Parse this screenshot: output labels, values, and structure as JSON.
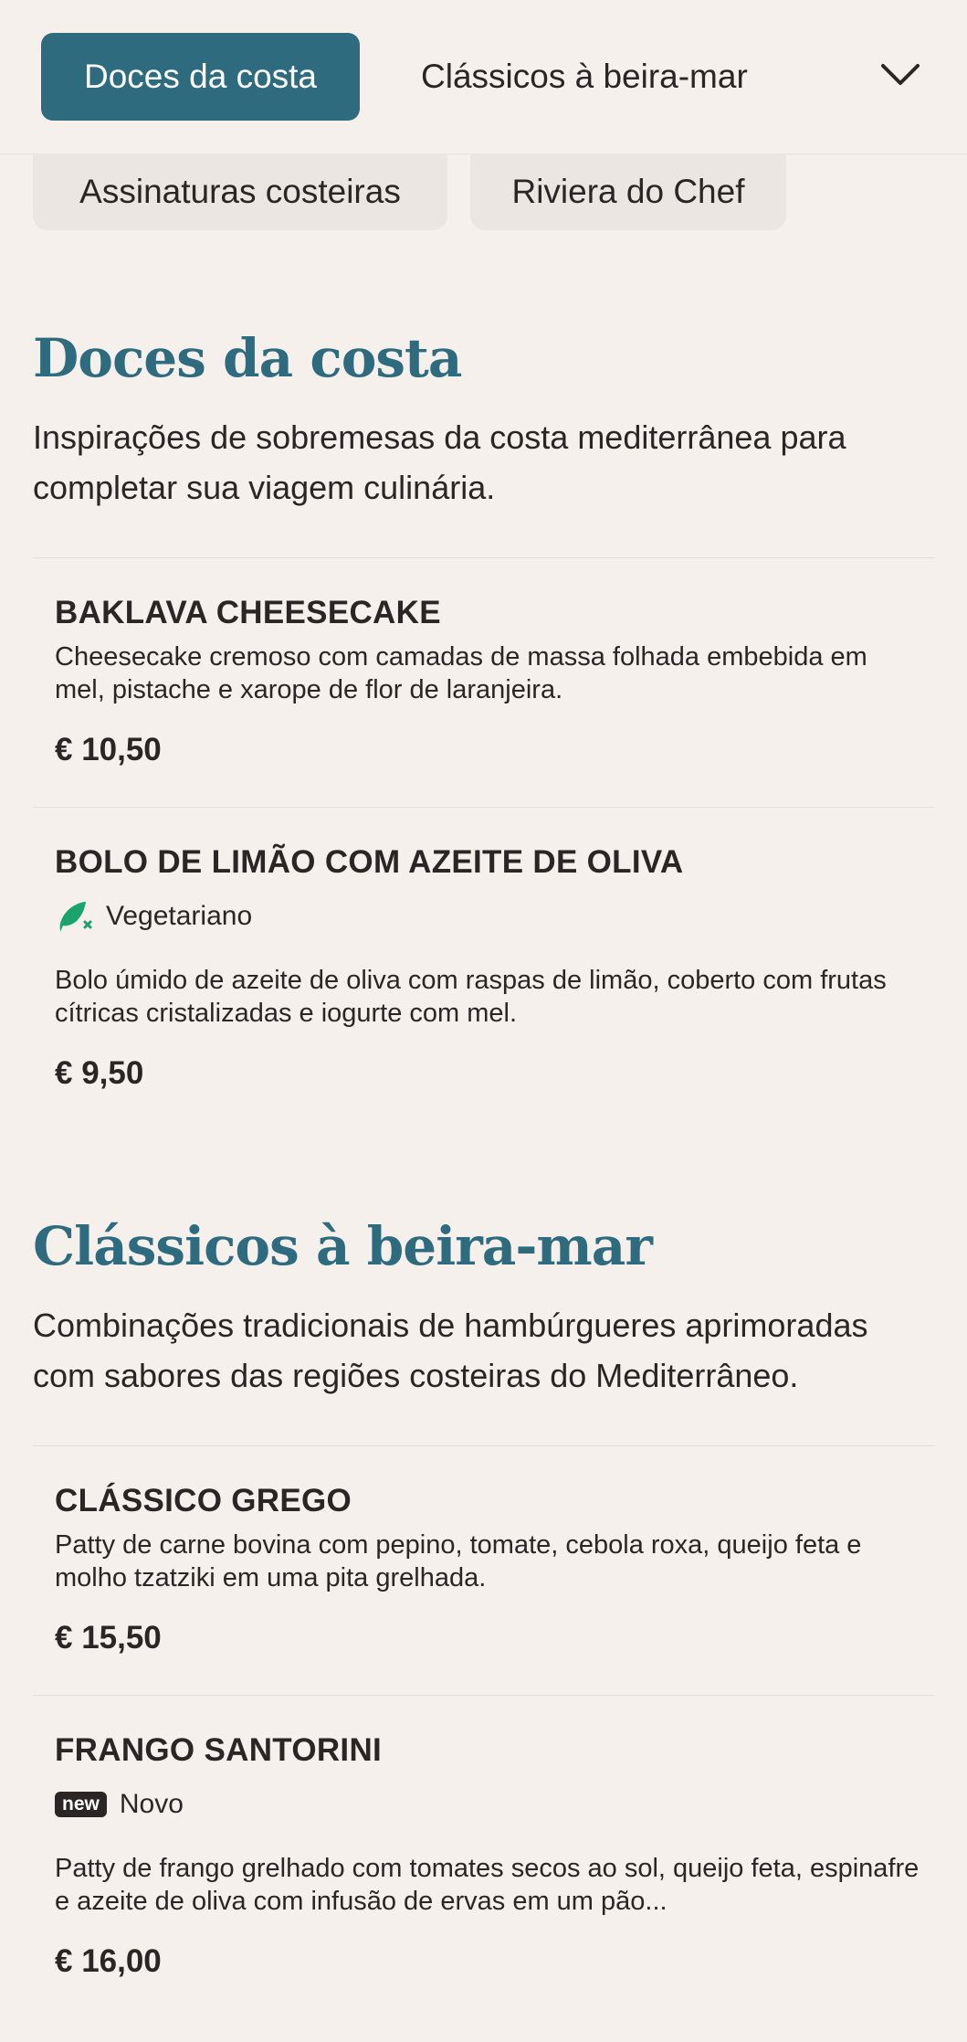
{
  "nav": {
    "tabs": [
      {
        "label": "Doces da costa",
        "active": true
      },
      {
        "label": "Clássicos à beira-mar",
        "active": false
      }
    ],
    "more_icon": "chevron-down-icon",
    "pills": [
      {
        "label": "Assinaturas costeiras"
      },
      {
        "label": "Riviera do Chef"
      }
    ]
  },
  "sections": [
    {
      "title": "Doces da costa",
      "description": "Inspirações de sobremesas da costa mediterrânea para completar sua viagem culinária.",
      "items": [
        {
          "name": "BAKLAVA CHEESECAKE",
          "description": "Cheesecake cremoso com camadas de massa folhada embebida em mel, pistache e xarope de flor de laranjeira.",
          "price": "€ 10,50"
        },
        {
          "name": "BOLO DE LIMÃO COM AZEITE DE OLIVA",
          "tag": {
            "label": "Vegetariano",
            "icon": "vegetarian-leaf-icon",
            "color": "#1aa36b"
          },
          "description": "Bolo úmido de azeite de oliva com raspas de limão, coberto com frutas cítricas cristalizadas e iogurte com mel.",
          "price": "€ 9,50"
        }
      ]
    },
    {
      "title": "Clássicos à beira-mar",
      "description": "Combinações tradicionais de hambúrgueres aprimoradas com sabores das regiões costeiras do Mediterrâneo.",
      "items": [
        {
          "name": "CLÁSSICO GREGO",
          "description": "Patty de carne bovina com pepino, tomate, cebola roxa, queijo feta e molho tzatziki em uma pita grelhada.",
          "price": "€ 15,50"
        },
        {
          "name": "FRANGO SANTORINI",
          "tag": {
            "label": "Novo",
            "badge": "new"
          },
          "description": "Patty de frango grelhado com tomates secos ao sol, queijo feta, espinafre e azeite de oliva com infusão de ervas em um pão...",
          "price": "€ 16,00"
        }
      ]
    }
  ],
  "colors": {
    "accent": "#2f6b7e",
    "background": "#f6f0ec",
    "pill_bg": "#ebe6e1",
    "text": "#2b2624",
    "vegetarian": "#1aa36b"
  }
}
